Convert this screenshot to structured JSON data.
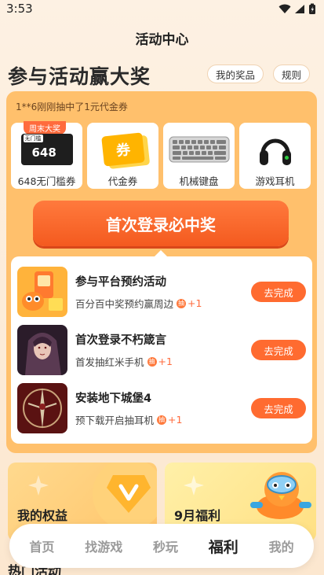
{
  "status": {
    "time": "3:53"
  },
  "header": {
    "title": "活动中心"
  },
  "hero": {
    "title": "参与活动赢大奖",
    "my_prizes": "我的奖品",
    "rules": "规则"
  },
  "ticker": "1**6刚刚抽中了1元代金券",
  "prizes": [
    {
      "label": "648无门槛券",
      "badge": "周末大奖",
      "card_tag": "无门槛",
      "card_value": "648"
    },
    {
      "label": "代金券",
      "glyph": "券"
    },
    {
      "label": "机械键盘"
    },
    {
      "label": "游戏耳机"
    }
  ],
  "cta": {
    "label": "首次登录必中奖"
  },
  "tasks": [
    {
      "title": "参与平台预约活动",
      "subtitle": "百分百中奖预约赢周边",
      "bonus": "+1",
      "button": "去完成"
    },
    {
      "title": "首次登录不朽箴言",
      "subtitle": "首发抽红米手机",
      "bonus": "+1",
      "button": "去完成"
    },
    {
      "title": "安装地下城堡4",
      "subtitle": "预下载开启抽耳机",
      "bonus": "+1",
      "button": "去完成"
    }
  ],
  "coin_glyph": "抽",
  "cards": {
    "benefits": "我的权益",
    "monthly": "9月福利"
  },
  "section_peek": "热门活动",
  "tabs": [
    "首页",
    "找游戏",
    "秒玩",
    "福利",
    "我的"
  ],
  "active_tab": "福利",
  "colors": {
    "accent": "#ff6b30",
    "card_bg": "#ffc06c"
  }
}
